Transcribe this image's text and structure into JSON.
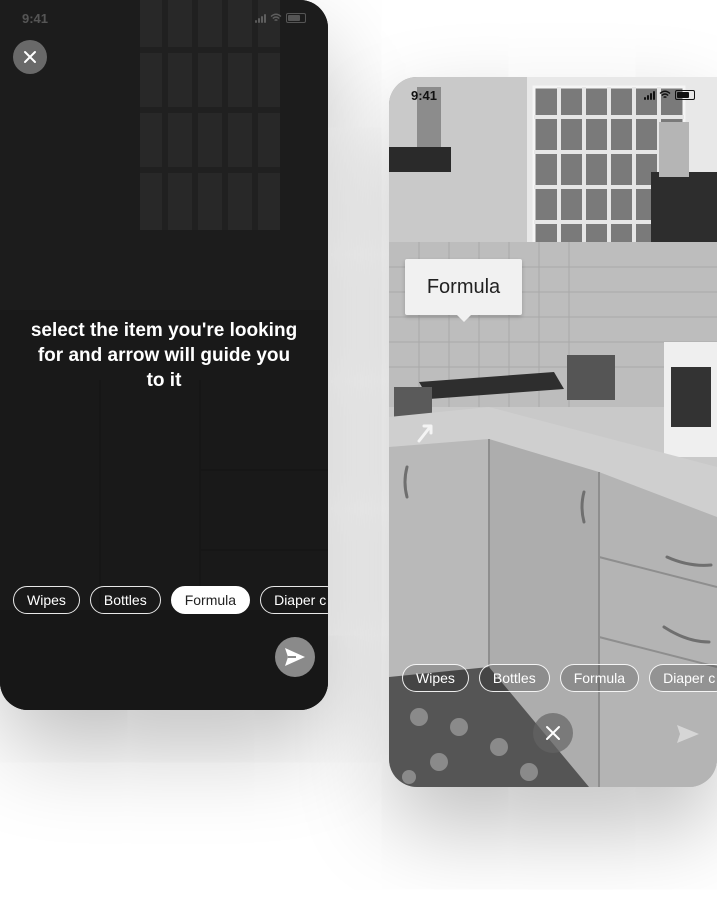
{
  "left_screen": {
    "status_time": "9:41",
    "instruction": "select the item you're looking for and arrow will guide you to it",
    "chips": [
      "Wipes",
      "Bottles",
      "Formula",
      "Diaper c"
    ],
    "selected_chip": "Formula"
  },
  "right_screen": {
    "status_time": "9:41",
    "tooltip_label": "Formula",
    "chips": [
      "Wipes",
      "Bottles",
      "Formula",
      "Diaper c"
    ]
  },
  "icons": {
    "close": "close-icon",
    "send": "send-icon",
    "arrow": "direction-arrow-icon"
  }
}
